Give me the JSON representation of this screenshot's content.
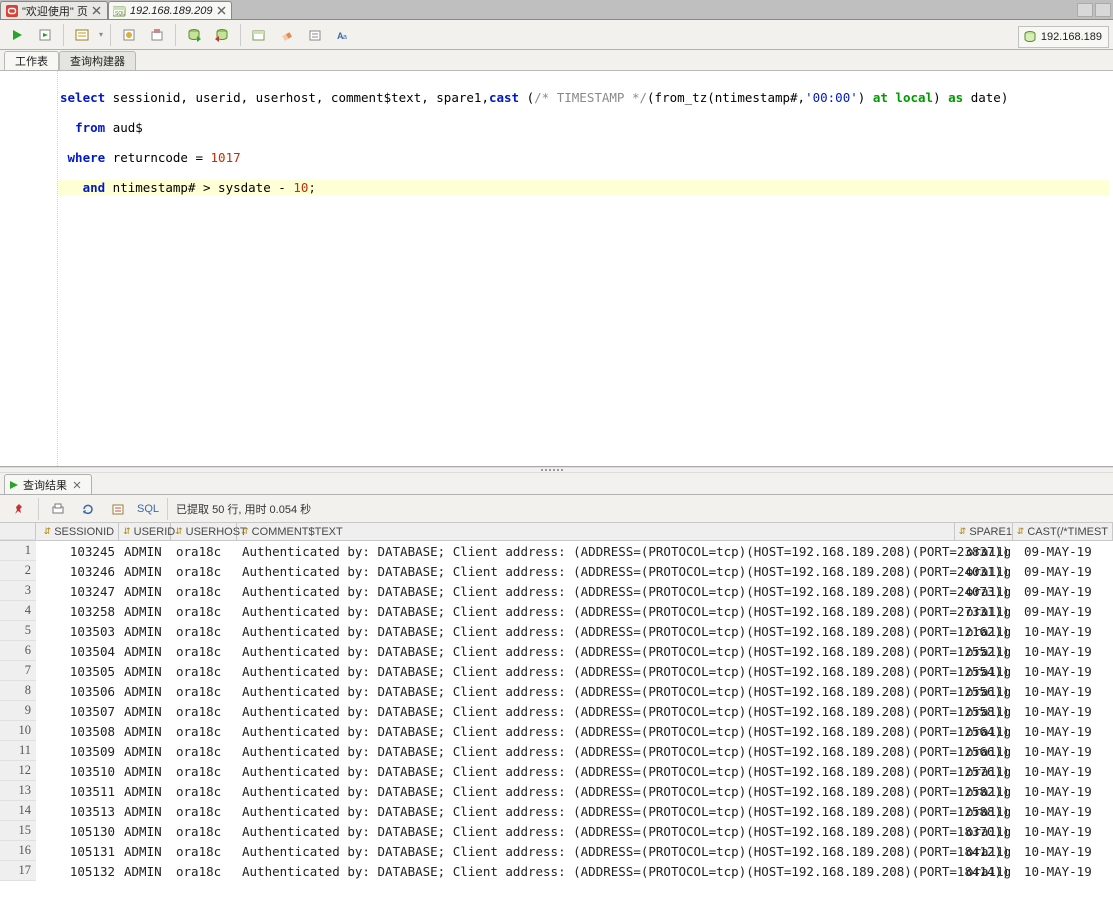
{
  "tabs": [
    {
      "icon": "o",
      "label": "\"欢迎使用\" 页",
      "active": false
    },
    {
      "icon": "sql",
      "label": "192.168.189.209",
      "active": true,
      "italic": true
    }
  ],
  "conn_label": "192.168.189",
  "subtabs": {
    "worksheet": "工作表",
    "builder": "查询构建器"
  },
  "sql": {
    "l1a": "select",
    "l1b": " sessionid, userid, userhost, comment$text, spare1,",
    "l1c": "cast",
    "l1d": " (",
    "l1cm": "/* TIMESTAMP */",
    "l1e": "(from_tz(ntimestamp#,",
    "l1str": "'00:00'",
    "l1f": ") ",
    "l1g": "at",
    "l1h": " ",
    "l1i": "local",
    "l1j": ") ",
    "l1k": "as",
    "l1l": " date)",
    "l2a": "from",
    "l2b": " aud$",
    "l3a": "where",
    "l3b": " returncode = ",
    "l3n": "1017",
    "l4a": "and",
    "l4b": " ntimestamp# > sysdate - ",
    "l4n": "10",
    "l4c": ";"
  },
  "result_tab": "查询结果",
  "sql_label": "SQL",
  "status": "已提取 50 行, 用时 0.054 秒",
  "columns": [
    "SESSIONID",
    "USERID",
    "USERHOST",
    "COMMENT$TEXT",
    "SPARE1",
    "CAST(/*TIMEST"
  ],
  "rows": [
    {
      "n": 1,
      "s": "103245",
      "u": "ADMIN",
      "h": "ora18c",
      "c": "Authenticated by: DATABASE; Client address: (ADDRESS=(PROTOCOL=tcp)(HOST=192.168.189.208)(PORT=23837))",
      "p": "ora11g",
      "d": "09-MAY-19"
    },
    {
      "n": 2,
      "s": "103246",
      "u": "ADMIN",
      "h": "ora18c",
      "c": "Authenticated by: DATABASE; Client address: (ADDRESS=(PROTOCOL=tcp)(HOST=192.168.189.208)(PORT=24031))",
      "p": "ora11g",
      "d": "09-MAY-19"
    },
    {
      "n": 3,
      "s": "103247",
      "u": "ADMIN",
      "h": "ora18c",
      "c": "Authenticated by: DATABASE; Client address: (ADDRESS=(PROTOCOL=tcp)(HOST=192.168.189.208)(PORT=24073))",
      "p": "ora11g",
      "d": "09-MAY-19"
    },
    {
      "n": 4,
      "s": "103258",
      "u": "ADMIN",
      "h": "ora18c",
      "c": "Authenticated by: DATABASE; Client address: (ADDRESS=(PROTOCOL=tcp)(HOST=192.168.189.208)(PORT=27331))",
      "p": "ora11g",
      "d": "09-MAY-19"
    },
    {
      "n": 5,
      "s": "103503",
      "u": "ADMIN",
      "h": "ora18c",
      "c": "Authenticated by: DATABASE; Client address: (ADDRESS=(PROTOCOL=tcp)(HOST=192.168.189.208)(PORT=12162))",
      "p": "ora11g",
      "d": "10-MAY-19"
    },
    {
      "n": 6,
      "s": "103504",
      "u": "ADMIN",
      "h": "ora18c",
      "c": "Authenticated by: DATABASE; Client address: (ADDRESS=(PROTOCOL=tcp)(HOST=192.168.189.208)(PORT=12552))",
      "p": "ora11g",
      "d": "10-MAY-19"
    },
    {
      "n": 7,
      "s": "103505",
      "u": "ADMIN",
      "h": "ora18c",
      "c": "Authenticated by: DATABASE; Client address: (ADDRESS=(PROTOCOL=tcp)(HOST=192.168.189.208)(PORT=12554))",
      "p": "ora11g",
      "d": "10-MAY-19"
    },
    {
      "n": 8,
      "s": "103506",
      "u": "ADMIN",
      "h": "ora18c",
      "c": "Authenticated by: DATABASE; Client address: (ADDRESS=(PROTOCOL=tcp)(HOST=192.168.189.208)(PORT=12556))",
      "p": "ora11g",
      "d": "10-MAY-19"
    },
    {
      "n": 9,
      "s": "103507",
      "u": "ADMIN",
      "h": "ora18c",
      "c": "Authenticated by: DATABASE; Client address: (ADDRESS=(PROTOCOL=tcp)(HOST=192.168.189.208)(PORT=12558))",
      "p": "ora11g",
      "d": "10-MAY-19"
    },
    {
      "n": 10,
      "s": "103508",
      "u": "ADMIN",
      "h": "ora18c",
      "c": "Authenticated by: DATABASE; Client address: (ADDRESS=(PROTOCOL=tcp)(HOST=192.168.189.208)(PORT=12564))",
      "p": "ora11g",
      "d": "10-MAY-19"
    },
    {
      "n": 11,
      "s": "103509",
      "u": "ADMIN",
      "h": "ora18c",
      "c": "Authenticated by: DATABASE; Client address: (ADDRESS=(PROTOCOL=tcp)(HOST=192.168.189.208)(PORT=12566))",
      "p": "ora11g",
      "d": "10-MAY-19"
    },
    {
      "n": 12,
      "s": "103510",
      "u": "ADMIN",
      "h": "ora18c",
      "c": "Authenticated by: DATABASE; Client address: (ADDRESS=(PROTOCOL=tcp)(HOST=192.168.189.208)(PORT=12576))",
      "p": "ora11g",
      "d": "10-MAY-19"
    },
    {
      "n": 13,
      "s": "103511",
      "u": "ADMIN",
      "h": "ora18c",
      "c": "Authenticated by: DATABASE; Client address: (ADDRESS=(PROTOCOL=tcp)(HOST=192.168.189.208)(PORT=12582))",
      "p": "ora11g",
      "d": "10-MAY-19"
    },
    {
      "n": 14,
      "s": "103513",
      "u": "ADMIN",
      "h": "ora18c",
      "c": "Authenticated by: DATABASE; Client address: (ADDRESS=(PROTOCOL=tcp)(HOST=192.168.189.208)(PORT=12588))",
      "p": "ora11g",
      "d": "10-MAY-19"
    },
    {
      "n": 15,
      "s": "105130",
      "u": "ADMIN",
      "h": "ora18c",
      "c": "Authenticated by: DATABASE; Client address: (ADDRESS=(PROTOCOL=tcp)(HOST=192.168.189.208)(PORT=18370))",
      "p": "ora11g",
      "d": "10-MAY-19"
    },
    {
      "n": 16,
      "s": "105131",
      "u": "ADMIN",
      "h": "ora18c",
      "c": "Authenticated by: DATABASE; Client address: (ADDRESS=(PROTOCOL=tcp)(HOST=192.168.189.208)(PORT=18412))",
      "p": "ora11g",
      "d": "10-MAY-19"
    },
    {
      "n": 17,
      "s": "105132",
      "u": "ADMIN",
      "h": "ora18c",
      "c": "Authenticated by: DATABASE; Client address: (ADDRESS=(PROTOCOL=tcp)(HOST=192.168.189.208)(PORT=18414))",
      "p": "ora11g",
      "d": "10-MAY-19"
    }
  ]
}
